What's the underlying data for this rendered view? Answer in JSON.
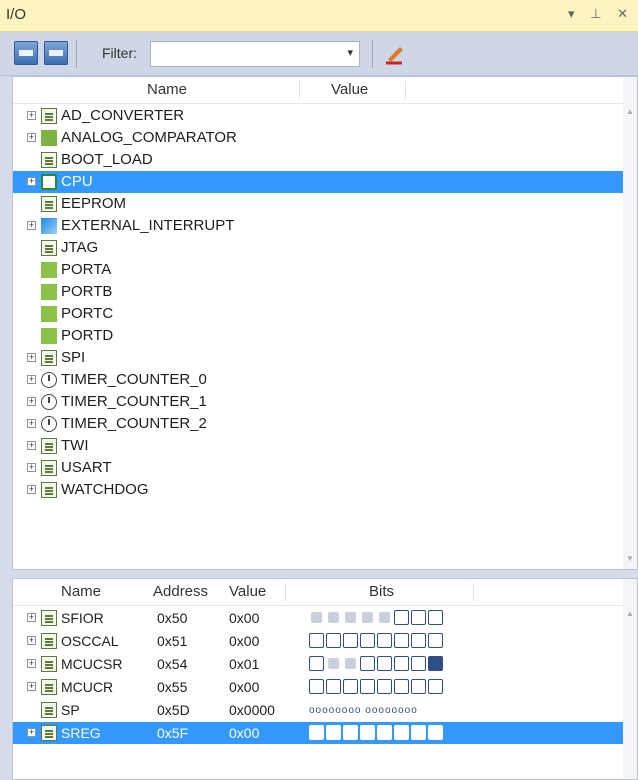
{
  "window": {
    "title": "I/O",
    "controls": "▾ ⊥ ✕"
  },
  "toolbar": {
    "filter_label": "Filter:",
    "filter_value": ""
  },
  "tree": {
    "headers": {
      "name": "Name",
      "value": "Value"
    },
    "items": [
      {
        "label": "AD_CONVERTER",
        "icon": "doc",
        "expandable": true
      },
      {
        "label": "ANALOG_COMPARATOR",
        "icon": "adc",
        "expandable": true
      },
      {
        "label": "BOOT_LOAD",
        "icon": "doc",
        "expandable": false
      },
      {
        "label": "CPU",
        "icon": "chip",
        "expandable": true,
        "selected": true
      },
      {
        "label": "EEPROM",
        "icon": "doc",
        "expandable": false
      },
      {
        "label": "EXTERNAL_INTERRUPT",
        "icon": "int",
        "expandable": true
      },
      {
        "label": "JTAG",
        "icon": "doc",
        "expandable": false
      },
      {
        "label": "PORTA",
        "icon": "io",
        "expandable": false
      },
      {
        "label": "PORTB",
        "icon": "io",
        "expandable": false
      },
      {
        "label": "PORTC",
        "icon": "io",
        "expandable": false
      },
      {
        "label": "PORTD",
        "icon": "io",
        "expandable": false
      },
      {
        "label": "SPI",
        "icon": "doc",
        "expandable": true
      },
      {
        "label": "TIMER_COUNTER_0",
        "icon": "clock",
        "expandable": true
      },
      {
        "label": "TIMER_COUNTER_1",
        "icon": "clock",
        "expandable": true
      },
      {
        "label": "TIMER_COUNTER_2",
        "icon": "clock",
        "expandable": true
      },
      {
        "label": "TWI",
        "icon": "doc",
        "expandable": true
      },
      {
        "label": "USART",
        "icon": "doc",
        "expandable": true
      },
      {
        "label": "WATCHDOG",
        "icon": "doc",
        "expandable": true
      }
    ]
  },
  "registers": {
    "headers": {
      "name": "Name",
      "address": "Address",
      "value": "Value",
      "bits": "Bits"
    },
    "rows": [
      {
        "name": "SFIOR",
        "address": "0x50",
        "value": "0x00",
        "bits": [
          "na",
          "na",
          "na",
          "na",
          "na",
          "off",
          "off",
          "off"
        ]
      },
      {
        "name": "OSCCAL",
        "address": "0x51",
        "value": "0x00",
        "bits": [
          "off",
          "off",
          "off",
          "off",
          "off",
          "off",
          "off",
          "off"
        ]
      },
      {
        "name": "MCUCSR",
        "address": "0x54",
        "value": "0x01",
        "bits": [
          "off",
          "na",
          "na",
          "off",
          "off",
          "off",
          "off",
          "set"
        ]
      },
      {
        "name": "MCUCR",
        "address": "0x55",
        "value": "0x00",
        "bits": [
          "off",
          "off",
          "off",
          "off",
          "off",
          "off",
          "off",
          "off"
        ]
      },
      {
        "name": "SP",
        "address": "0x5D",
        "value": "0x0000",
        "tiny_bits": "oooooooo oooooooo"
      },
      {
        "name": "SREG",
        "address": "0x5F",
        "value": "0x00",
        "bits": [
          "off",
          "off",
          "off",
          "off",
          "off",
          "off",
          "off",
          "off"
        ],
        "selected": true
      }
    ]
  },
  "colors": {
    "selection": "#3399ff",
    "bit_border": "#2e4f86",
    "titlebar": "#fdf4bf"
  }
}
